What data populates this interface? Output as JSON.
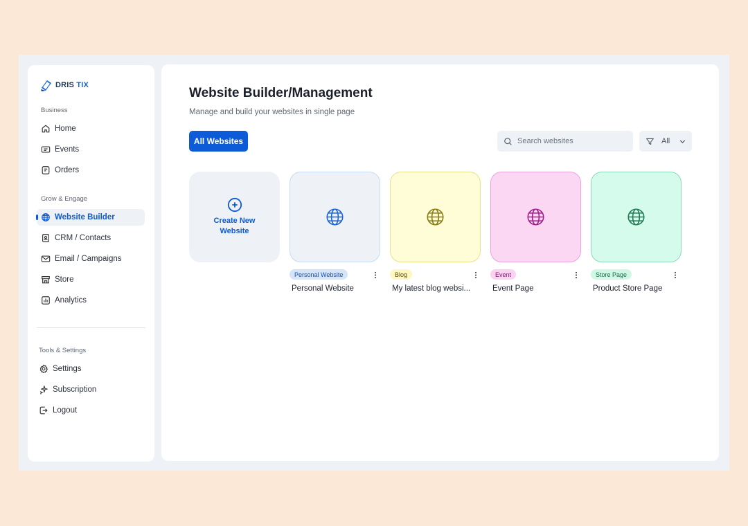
{
  "brand": {
    "name_part1": "DRIS",
    "name_part2": "TIX"
  },
  "sidebar": {
    "sections": [
      {
        "label": "Business"
      },
      {
        "label": "Grow & Engage"
      },
      {
        "label": "Tools & Settings"
      }
    ],
    "items": [
      {
        "label": "Home",
        "icon": "home-icon"
      },
      {
        "label": "Events",
        "icon": "ticket-icon"
      },
      {
        "label": "Orders",
        "icon": "receipt-icon"
      },
      {
        "label": "Website Builder",
        "icon": "globe-icon",
        "active": true
      },
      {
        "label": "CRM / Contacts",
        "icon": "contacts-icon"
      },
      {
        "label": "Email / Campaigns",
        "icon": "mail-icon"
      },
      {
        "label": "Store",
        "icon": "store-icon"
      },
      {
        "label": "Analytics",
        "icon": "chart-icon"
      },
      {
        "label": "Settings",
        "icon": "gear-icon"
      },
      {
        "label": "Subscription",
        "icon": "sparkle-icon"
      },
      {
        "label": "Logout",
        "icon": "logout-icon"
      }
    ]
  },
  "header": {
    "title": "Website Builder/Management",
    "subtitle": "Manage and build your websites in single page"
  },
  "toolbar": {
    "all_websites_label": "All Websites",
    "search_placeholder": "Search websites",
    "filter_value": "All"
  },
  "create_card": {
    "label": "Create New Website"
  },
  "websites": [
    {
      "tag": "Personal Website",
      "title": "Personal Website",
      "bg": "#eef1f6",
      "border": "#c6dbf5",
      "globe": "#1565d8",
      "tag_bg": "#d4e4fb",
      "tag_color": "#1a4fa8"
    },
    {
      "tag": "Blog",
      "title": "My latest blog websi...",
      "bg": "#fefdd8",
      "border": "#e9e18c",
      "globe": "#8a7a10",
      "tag_bg": "#fdf7c2",
      "tag_color": "#5a4d06"
    },
    {
      "tag": "Event",
      "title": "Event Page",
      "bg": "#fcd7f3",
      "border": "#eaa4dc",
      "globe": "#a31b8a",
      "tag_bg": "#fbd2f1",
      "tag_color": "#8b1473"
    },
    {
      "tag": "Store Page",
      "title": "Product Store Page",
      "bg": "#d5fbec",
      "border": "#8fd9b8",
      "globe": "#1f7a55",
      "tag_bg": "#d0f8e6",
      "tag_color": "#1a6a48"
    }
  ]
}
